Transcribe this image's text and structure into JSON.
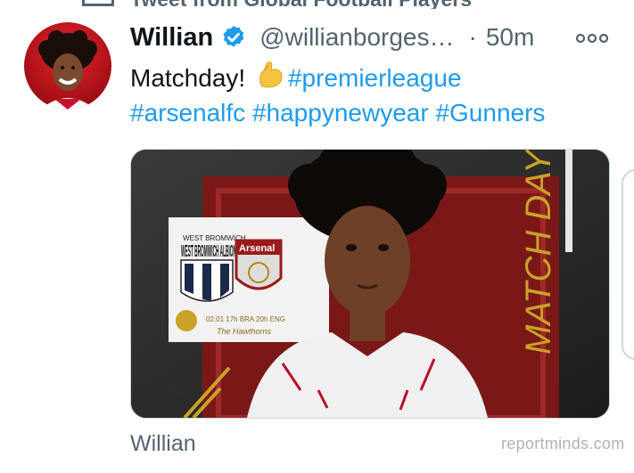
{
  "header": {
    "context_text": "Tweet from Global Football Players"
  },
  "tweet": {
    "author_name": "Willian",
    "handle": "@willianborges…",
    "separator": "·",
    "time": "50m",
    "text": {
      "plain": "Matchday!",
      "hashtag_1": "#premierleague",
      "hashtag_2": "#arsenalfc",
      "hashtag_3": "#happynewyear",
      "hashtag_4": "#Gunners"
    },
    "media": {
      "team_home": "WEST BROMWICH ALBION",
      "team_away": "Arsenal",
      "match_info": "02.01  17h BRA  20h ENG",
      "venue": "The Hawthorns",
      "side_text": "MATCH DAY"
    },
    "media_author": "Willian"
  },
  "watermark": "reportminds.com",
  "colors": {
    "accent": "#1d9bf0",
    "secondary_text": "#536471",
    "border": "#cfd9de"
  },
  "icons": {
    "verified": "verified-badge-icon",
    "more": "more-options-icon",
    "emoji": "flexed-biceps-emoji"
  }
}
